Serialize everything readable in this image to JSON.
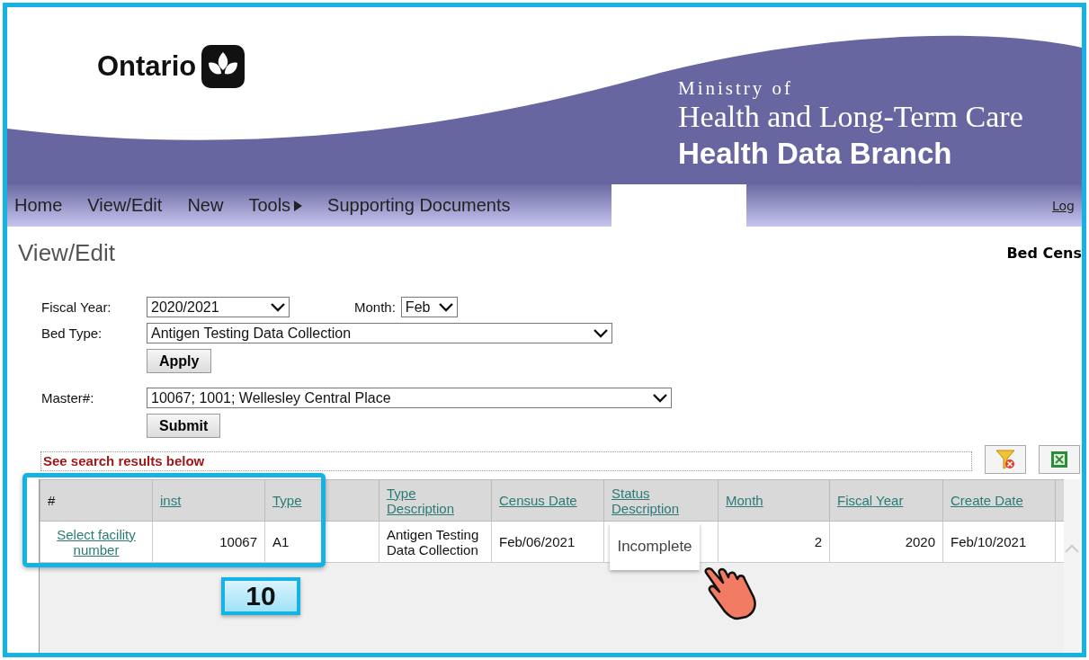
{
  "header": {
    "brand": "Ontario",
    "ministry_line": "Ministry of",
    "ministry_name": "Health and Long-Term Care",
    "branch": "Health Data Branch"
  },
  "nav": {
    "items": [
      {
        "label": "Home",
        "kind": "link"
      },
      {
        "label": "View/Edit",
        "kind": "link"
      },
      {
        "label": "New",
        "kind": "link"
      },
      {
        "label": "Tools",
        "kind": "submenu"
      },
      {
        "label": "Supporting Documents",
        "kind": "link"
      }
    ],
    "logout": "Log"
  },
  "page": {
    "title": "View/Edit",
    "app_title": "Bed Cens"
  },
  "filters": {
    "fiscal_year": {
      "label": "Fiscal Year:",
      "value": "2020/2021"
    },
    "month": {
      "label": "Month:",
      "value": "Feb"
    },
    "bed_type": {
      "label": "Bed Type:",
      "value": "Antigen Testing Data Collection"
    },
    "apply": "Apply",
    "master": {
      "label": "Master#:",
      "value": "10067; 1001; Wellesley Central Place"
    },
    "submit": "Submit"
  },
  "results": {
    "message": "See search results below",
    "columns": [
      {
        "label": "#",
        "sortable": false
      },
      {
        "label": "inst",
        "sortable": true
      },
      {
        "label": "Type",
        "sortable": true
      },
      {
        "label": "Type Description",
        "sortable": true
      },
      {
        "label": "Census Date",
        "sortable": true
      },
      {
        "label": "Status Description",
        "sortable": true
      },
      {
        "label": "Month",
        "sortable": true
      },
      {
        "label": "Fiscal Year",
        "sortable": true
      },
      {
        "label": "Create Date",
        "sortable": true
      }
    ],
    "rows": [
      {
        "cells": [
          {
            "text": "Select facility number",
            "kind": "link"
          },
          {
            "text": "10067",
            "kind": "number"
          },
          {
            "text": "A1",
            "kind": "text"
          },
          {
            "text": "Antigen Testing Data Collection",
            "kind": "text"
          },
          {
            "text": "Feb/06/2021",
            "kind": "text"
          },
          {
            "text": "Incomplete",
            "kind": "highlight"
          },
          {
            "text": "2",
            "kind": "number"
          },
          {
            "text": "2020",
            "kind": "number"
          },
          {
            "text": "Feb/10/2021",
            "kind": "text"
          }
        ]
      }
    ]
  },
  "annotation": {
    "step": "10"
  }
}
